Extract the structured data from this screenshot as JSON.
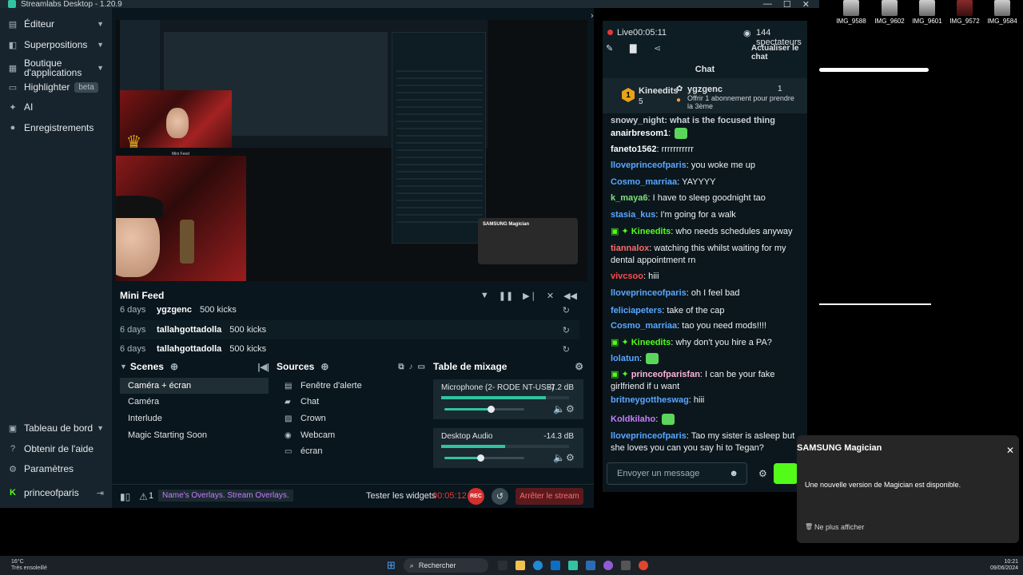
{
  "titlebar": {
    "title": "Streamlabs Desktop - 1.20.9"
  },
  "sidebar": {
    "items": [
      {
        "label": "Éditeur",
        "icon": "editor-icon",
        "chevron": true
      },
      {
        "label": "Superpositions",
        "icon": "overlays-icon",
        "chevron": true
      },
      {
        "label": "Boutique d'applications",
        "icon": "app-store-icon",
        "chevron": true
      },
      {
        "label": "Highlighter",
        "icon": "highlighter-icon",
        "badge": "beta"
      },
      {
        "label": "AI",
        "icon": "ai-icon"
      },
      {
        "label": "Enregistrements",
        "icon": "recordings-icon"
      }
    ],
    "bottom": [
      {
        "label": "Tableau de bord",
        "icon": "dashboard-icon",
        "chevron": true
      },
      {
        "label": "Obtenir de l'aide",
        "icon": "help-icon"
      },
      {
        "label": "Paramètres",
        "icon": "settings-icon"
      }
    ],
    "user": "princeofparis"
  },
  "minifeed": {
    "title": "Mini Feed",
    "rows": [
      {
        "age": "6 days",
        "name": "ygzgenc",
        "amount": "500 kicks"
      },
      {
        "age": "6 days",
        "name": "tallahgottadolla",
        "amount": "500 kicks"
      },
      {
        "age": "6 days",
        "name": "tallahgottadolla",
        "amount": "500 kicks"
      }
    ]
  },
  "scenes": {
    "title": "Scenes",
    "items": [
      "Caméra + écran",
      "Caméra",
      "Interlude",
      "Magic Starting Soon"
    ]
  },
  "sources": {
    "title": "Sources",
    "items": [
      {
        "label": "Fenêtre d'alerte",
        "icon": "alert-box-icon"
      },
      {
        "label": "Chat",
        "icon": "chat-icon"
      },
      {
        "label": "Crown",
        "icon": "image-icon"
      },
      {
        "label": "Webcam",
        "icon": "webcam-icon"
      },
      {
        "label": "écran",
        "icon": "monitor-icon"
      }
    ]
  },
  "mixer": {
    "title": "Table de mixage",
    "channels": [
      {
        "name": "Microphone (2- RODE NT-USB)",
        "db": "-7.2 dB",
        "level": 0.82,
        "volume": 0.58
      },
      {
        "name": "Desktop Audio",
        "db": "-14.3 dB",
        "level": 0.5,
        "volume": 0.45
      }
    ]
  },
  "footer": {
    "alert_count": "1",
    "promo": "Name's Overlays. Stream Overlays.",
    "test_widgets": "Tester les widgets",
    "timer": "00:05:12",
    "rec": "REC",
    "stop_stream": "Arrêter le stream"
  },
  "live": {
    "status": "Live",
    "time": "00:05:11",
    "viewers": "144 spectateurs",
    "refresh": "Actualiser le chat"
  },
  "chat": {
    "title": "Chat",
    "pinned": {
      "rank": "1",
      "name": "Kineedits",
      "count": "5",
      "gifter": "ygzgenc",
      "gift_count": "1",
      "gift_text": "Offrir 1 abonnement pour prendre la 3ème"
    },
    "partial": "snowy_night: what is the focused thing",
    "messages": [
      {
        "user": "anairbresom1",
        "text": "",
        "color": "#ffffff",
        "emote": true
      },
      {
        "user": "faneto1562",
        "text": "rrrrrrrrrrr",
        "color": "#ffffff"
      },
      {
        "user": "lloveprinceofparis",
        "text": "you woke me up",
        "color": "#5aa7ff"
      },
      {
        "user": "Cosmo_marriaa",
        "text": "YAYYYY",
        "color": "#5aa7ff"
      },
      {
        "user": "k_maya6",
        "text": "I have to sleep goodnight tao",
        "color": "#7ee07a"
      },
      {
        "user": "stasia_kus",
        "text": "I'm going for a walk",
        "color": "#5aa7ff"
      },
      {
        "user": "Kineedits",
        "text": "who needs schedules anyway",
        "color": "#53fc18",
        "badges": true
      },
      {
        "user": "tiannalox",
        "text": "watching this whilst waiting for my dental appointment rn",
        "color": "#ff6b6b"
      },
      {
        "user": "vivcsoo",
        "text": "hiii",
        "color": "#ff4b4b"
      },
      {
        "user": "lloveprinceofparis",
        "text": "oh I feel bad",
        "color": "#5aa7ff"
      },
      {
        "user": "feliciapeters",
        "text": "take of the cap",
        "color": "#5aa7ff"
      },
      {
        "user": "Cosmo_marriaa",
        "text": "tao you need mods!!!!",
        "color": "#5aa7ff"
      },
      {
        "user": "Kineedits",
        "text": "why don't you hire a PA?",
        "color": "#53fc18",
        "badges": true
      },
      {
        "user": "lolatun",
        "text": "",
        "color": "#5aa7ff",
        "emote": true
      },
      {
        "user": "princeofparisfan",
        "text": "I can be your fake girlfriend if u want",
        "color": "#ffb3d9",
        "badges": true
      },
      {
        "user": "britneygottheswag",
        "text": "hiii",
        "color": "#5aa7ff"
      },
      {
        "user": "Koldkilaho",
        "text": "",
        "color": "#c77dff",
        "emote": true
      },
      {
        "user": "lloveprinceofparis",
        "text": "Tao my sister is asleep but she loves you can you say hi to Tegan?",
        "color": "#5aa7ff"
      }
    ],
    "input_placeholder": "Envoyer un message"
  },
  "desktop_files": [
    "IMG_9588",
    "IMG_9602",
    "IMG_9601",
    "IMG_9572",
    "IMG_9584"
  ],
  "notification": {
    "app": "SAMSUNG Magician",
    "message": "Une nouvelle version de Magician est disponible.",
    "action": "Ne plus afficher"
  },
  "taskbar": {
    "weather_temp": "16°C",
    "weather_desc": "Très ensoleillé",
    "search": "Rechercher",
    "time": "10:21",
    "date": "09/06/2024"
  },
  "preview_overlay": {
    "mini_feed_label": "Mini Feed",
    "samsung_label": "SAMSUNG Magician"
  },
  "colors": {
    "accent": "#31c3a2",
    "live_red": "#e53935",
    "kick_green": "#53fc18"
  }
}
